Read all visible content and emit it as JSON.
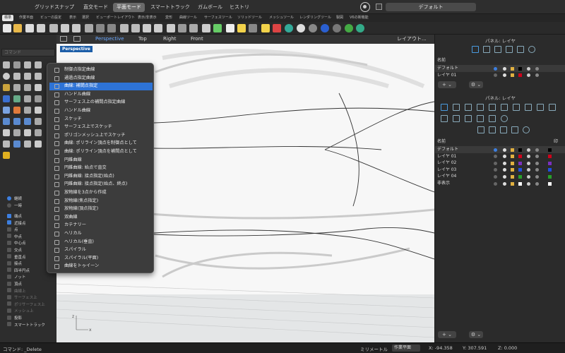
{
  "top_modes": [
    {
      "label": "グリッドスナップ",
      "active": false
    },
    {
      "label": "直交モード",
      "active": false
    },
    {
      "label": "平面モード",
      "active": true
    },
    {
      "label": "スマートトラック",
      "active": false
    },
    {
      "label": "ガムボール",
      "active": false
    },
    {
      "label": "ヒストリ",
      "active": false
    }
  ],
  "cplane_selector": "デフォルト",
  "toolbar_tabs": [
    "標準",
    "作業平面",
    "ビューの設定",
    "表示",
    "選択",
    "ビューポートレイアウト",
    "表示/非表示",
    "変形",
    "曲線ツール",
    "サーフェスツール",
    "ソリッドツール",
    "メッシュツール",
    "レンダリングツール",
    "製図",
    "V6の新機能"
  ],
  "command_placeholder": "コマンド",
  "view_tabs": [
    "Perspective",
    "Top",
    "Right",
    "Front"
  ],
  "layout_label": "レイアウト...",
  "viewport_label": "Perspective",
  "menu_items": [
    "制御点指定曲線",
    "通過点指定曲線",
    "曲線: 補間点指定",
    "ハンドル曲線",
    "サーフェス上の補間点指定曲線",
    "ハンドル曲線",
    "スケッチ",
    "サーフェス上でスケッチ",
    "ポリゴンメッシュ上でスケッチ",
    "曲線: ポリライン頂点を制御点として",
    "曲線: ポリライン頂点を補間点として",
    "円錐曲線",
    "円錐曲線: 始点で直交",
    "円錐曲線: 接点指定(始点)",
    "円錐曲線: 接点指定(始点、終点)",
    "放物線を3点から作成",
    "放物線(焦点指定)",
    "放物線(頂点指定)",
    "双曲線",
    "カテナリー",
    "ヘリカル",
    "ヘリカル(垂直)",
    "スパイラル",
    "スパイラル(平面)",
    "曲線をトゥイーン"
  ],
  "menu_selected_index": 2,
  "osnap": {
    "modes": [
      {
        "label": "継続",
        "on": true
      },
      {
        "label": "一時",
        "on": false
      }
    ],
    "items": [
      {
        "label": "端点",
        "on": true,
        "dim": false
      },
      {
        "label": "近接点",
        "on": true,
        "dim": false
      },
      {
        "label": "点",
        "on": false,
        "dim": false
      },
      {
        "label": "中点",
        "on": false,
        "dim": false
      },
      {
        "label": "中心点",
        "on": false,
        "dim": false
      },
      {
        "label": "交点",
        "on": false,
        "dim": false
      },
      {
        "label": "垂直点",
        "on": false,
        "dim": false
      },
      {
        "label": "接点",
        "on": false,
        "dim": false
      },
      {
        "label": "四半円点",
        "on": false,
        "dim": false
      },
      {
        "label": "ノット",
        "on": false,
        "dim": false
      },
      {
        "label": "頂点",
        "on": false,
        "dim": false
      },
      {
        "label": "曲線上",
        "on": false,
        "dim": true
      },
      {
        "label": "サーフェス上",
        "on": false,
        "dim": true
      },
      {
        "label": "ポリサーフェス上",
        "on": false,
        "dim": true
      },
      {
        "label": "メッシュ上",
        "on": false,
        "dim": true
      },
      {
        "label": "投影",
        "on": false,
        "dim": false
      },
      {
        "label": "スマートトラック",
        "on": false,
        "dim": false
      }
    ]
  },
  "panel_top": {
    "title": "パネル: レイヤ",
    "header": "名前",
    "layers": [
      {
        "name": "デフォルト",
        "color": "#000000"
      },
      {
        "name": "レイヤ 01",
        "color": "#d0021b"
      }
    ]
  },
  "panel_bottom": {
    "title": "パネル: レイヤ",
    "header": "名前",
    "header_right": "印",
    "layers": [
      {
        "name": "デフォルト",
        "color": "#000000",
        "swatch2": "#000000"
      },
      {
        "name": "レイヤ 01",
        "color": "#d0021b",
        "swatch2": "#d0021b"
      },
      {
        "name": "レイヤ 02",
        "color": "#7b2fbf",
        "swatch2": "#7b2fbf"
      },
      {
        "name": "レイヤ 03",
        "color": "#1f4fe0",
        "swatch2": "#1f4fe0"
      },
      {
        "name": "レイヤ 04",
        "color": "#27a02a",
        "swatch2": "#27a02a"
      },
      {
        "name": "非表示",
        "color": "#ffffff",
        "swatch2": "#ffffff"
      }
    ]
  },
  "status": {
    "command": "コマンド: _Delete",
    "unit": "ミリメートル",
    "plane": "作業平面",
    "x": "X: -94.358",
    "y": "Y: 307.591",
    "z": "Z: 0.000"
  },
  "colors": {
    "accent": "#2e73d6",
    "active_view": "#6aa8ff",
    "viewport_label_bg": "#1d5ea8"
  }
}
